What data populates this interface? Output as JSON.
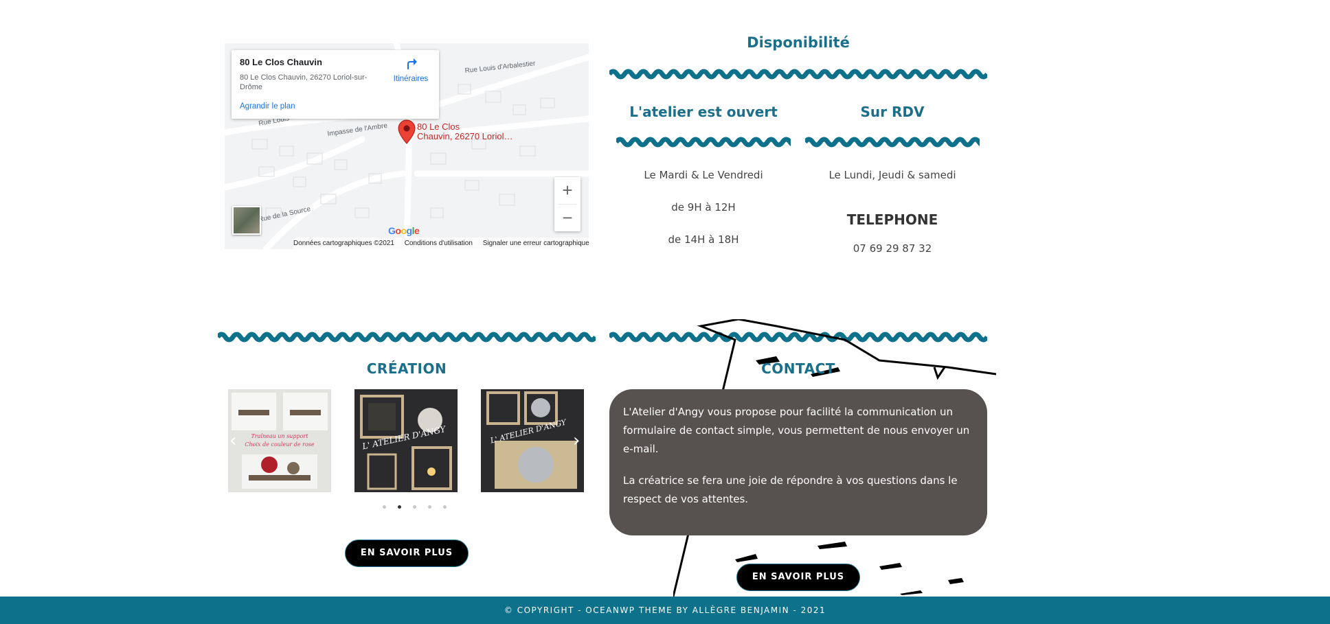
{
  "map": {
    "place_name": "80 Le Clos Chauvin",
    "address": "80 Le Clos Chauvin, 26270 Loriol-sur-Drôme",
    "directions_label": "Itinéraires",
    "enlarge_label": "Agrandir le plan",
    "pin_label_line1": "80 Le Clos",
    "pin_label_line2": "Chauvin, 26270 Loriol…",
    "streets": [
      "Rue Louis d'Arbalestier",
      "Impasse de l'Ambre",
      "Rue Louis",
      "Rue de la Source"
    ],
    "zoom_in": "+",
    "zoom_out": "−",
    "google_logo": "Google",
    "attribution": [
      "Données cartographiques ©2021",
      "Conditions d'utilisation",
      "Signaler une erreur cartographique"
    ]
  },
  "availability": {
    "title": "Disponibilité",
    "open": {
      "title": "L'atelier est ouvert",
      "days": "Le Mardi & Le Vendredi",
      "morning": "de 9H à 12H",
      "afternoon": "de 14H à 18H"
    },
    "rdv": {
      "title": "Sur RDV",
      "days": "Le Lundi, Jeudi & samedi",
      "phone_title": "TELEPHONE",
      "phone": "07 69 29 87 32"
    }
  },
  "creation": {
    "title": "CRÉATION",
    "slides": [
      {
        "caption_line1": "Traîneau un support",
        "caption_line2": "Choix de couleur de rose"
      },
      {
        "caption_line1": "L' ATELIER D'ANGY"
      },
      {
        "caption_line1": "L' ATELIER D'ANGY"
      }
    ],
    "dots_count": 5,
    "active_dot": 1,
    "prev_icon": "‹",
    "next_icon": "›",
    "button": "EN SAVOIR PLUS"
  },
  "contact": {
    "title": "CONTACT",
    "paragraph1": "L'Atelier d'Angy vous propose pour facilité la communication un formulaire de contact simple, vous permettent de nous envoyer un e-mail.",
    "paragraph2": "La créatrice se fera une joie de répondre à vos questions dans le respect de vos attentes.",
    "button": "EN SAVOIR PLUS"
  },
  "footer": {
    "text": "© COPYRIGHT - OCEANWP THEME BY ALLÈGRE BENJAMIN - 2021"
  },
  "colors": {
    "teal": "#0d718c",
    "contact_box": "#575150",
    "button": "#000000"
  }
}
